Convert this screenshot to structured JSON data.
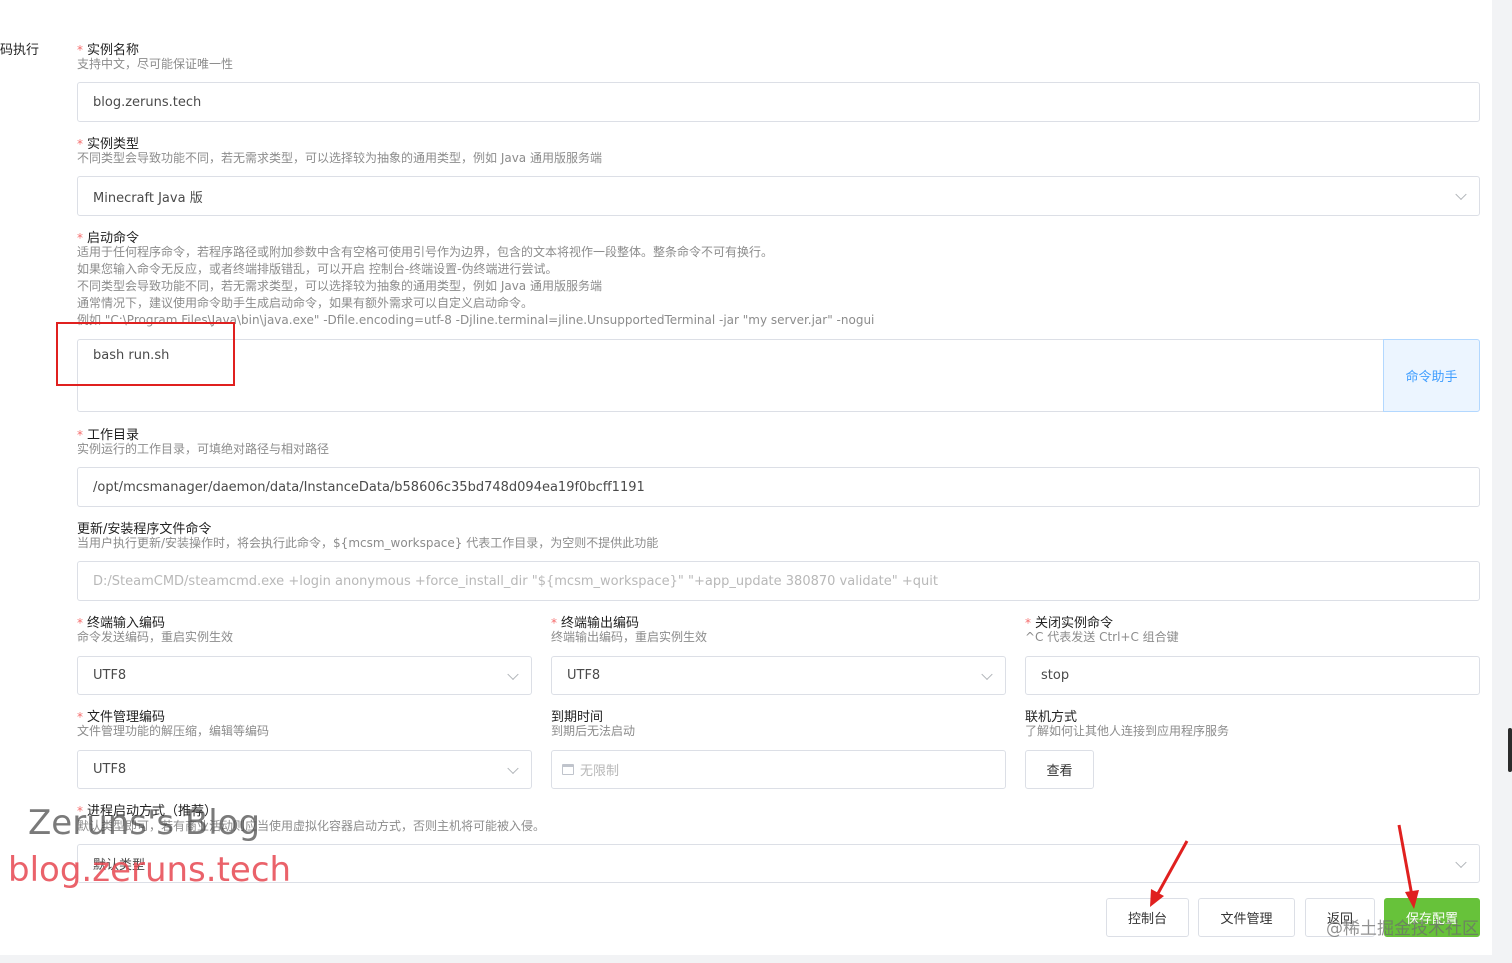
{
  "sidebar": {
    "fragment": "码执行"
  },
  "fields": {
    "instance_name": {
      "label": "实例名称",
      "hint": "支持中文，尽可能保证唯一性",
      "value": "blog.zeruns.tech"
    },
    "instance_type": {
      "label": "实例类型",
      "hint": "不同类型会导致功能不同，若无需求类型，可以选择较为抽象的通用类型，例如 Java 通用版服务端",
      "value": "Minecraft Java 版"
    },
    "start_command": {
      "label": "启动命令",
      "hints": [
        "适用于任何程序命令，若程序路径或附加参数中含有空格可使用引号作为边界，包含的文本将视作一段整体。整条命令不可有换行。",
        "如果您输入命令无反应，或者终端排版错乱，可以开启 控制台-终端设置-伪终端进行尝试。",
        "不同类型会导致功能不同，若无需求类型，可以选择较为抽象的通用类型，例如 Java 通用版服务端",
        "通常情况下，建议使用命令助手生成启动命令，如果有额外需求可以自定义启动命令。",
        "例如 \"C:\\Program Files\\Java\\bin\\java.exe\" -Dfile.encoding=utf-8 -Djline.terminal=jline.UnsupportedTerminal -jar \"my server.jar\" -nogui"
      ],
      "value": "bash run.sh",
      "helper_button": "命令助手"
    },
    "work_dir": {
      "label": "工作目录",
      "hint": "实例运行的工作目录，可填绝对路径与相对路径",
      "value": "/opt/mcsmanager/daemon/data/InstanceData/b58606c35bd748d094ea19f0bcff1191"
    },
    "update_cmd": {
      "label": "更新/安装程序文件命令",
      "hint": "当用户执行更新/安装操作时，将会执行此命令，${mcsm_workspace} 代表工作目录，为空则不提供此功能",
      "placeholder": "D:/SteamCMD/steamcmd.exe +login anonymous +force_install_dir \"${mcsm_workspace}\" \"+app_update 380870 validate\" +quit"
    },
    "input_encoding": {
      "label": "终端输入编码",
      "hint": "命令发送编码，重启实例生效",
      "value": "UTF8"
    },
    "output_encoding": {
      "label": "终端输出编码",
      "hint": "终端输出编码，重启实例生效",
      "value": "UTF8"
    },
    "stop_command": {
      "label": "关闭实例命令",
      "hint": "^C 代表发送 Ctrl+C 组合键",
      "value": "stop"
    },
    "file_encoding": {
      "label": "文件管理编码",
      "hint": "文件管理功能的解压缩，编辑等编码",
      "value": "UTF8"
    },
    "expire_time": {
      "label": "到期时间",
      "hint": "到期后无法启动",
      "placeholder": "无限制"
    },
    "connect_method": {
      "label": "联机方式",
      "hint": "了解如何让其他人连接到应用程序服务",
      "button": "查看"
    },
    "process_type": {
      "label": "进程启动方式（推荐）",
      "hint": "默认类型即可，若有商业活动则应当使用虚拟化容器启动方式，否则主机将可能被入侵。",
      "value": "默认类型"
    }
  },
  "footer": {
    "console": "控制台",
    "files": "文件管理",
    "back": "返回",
    "save": "保存配置"
  },
  "watermarks": {
    "blog_title": "Zeruns's Blog",
    "blog_url": "blog.zeruns.tech",
    "community": "@稀土掘金技术社区"
  },
  "colors": {
    "accent": "#409eff",
    "save_green": "#67c23a",
    "required": "#f56c6c",
    "annotation_red": "#e0201f"
  }
}
